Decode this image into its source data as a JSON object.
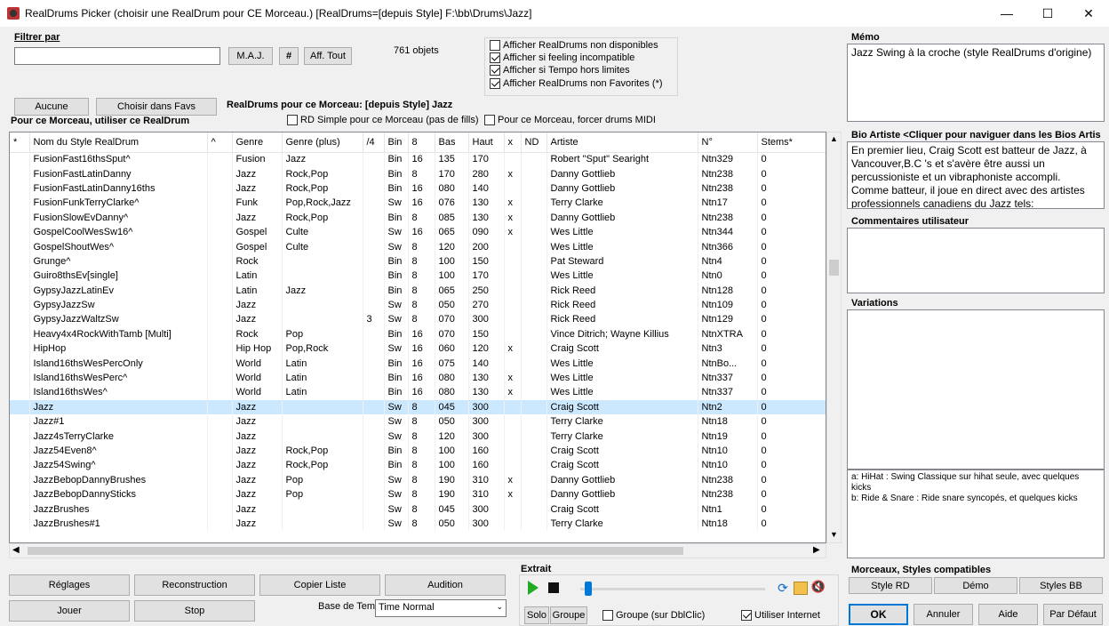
{
  "window": {
    "title": "RealDrums Picker (choisir une RealDrum pour CE Morceau.)  [RealDrums=[depuis Style] F:\\bb\\Drums\\Jazz]",
    "min": "—",
    "max": "☐",
    "close": "✕"
  },
  "filter": {
    "label": "Filtrer par",
    "value": "",
    "update": "M.A.J.",
    "hash": "#",
    "show_all": "Aff. Tout",
    "count": "761 objets"
  },
  "options": {
    "unavailable": "Afficher RealDrums non disponibles",
    "feel": "Afficher si feeling incompatible",
    "tempo": "Afficher si Tempo hors limites",
    "nonfav": "Afficher RealDrums non Favorites (*)"
  },
  "actions": {
    "none": "Aucune",
    "favs": "Choisir dans Favs",
    "for_song_title": "RealDrums pour ce Morceau: [depuis Style] Jazz",
    "use_label": "Pour ce Morceau, utiliser ce RealDrum",
    "simple_rd": "RD Simple pour ce Morceau (pas de fills)",
    "force_midi": "Pour ce Morceau, forcer drums MIDI"
  },
  "table": {
    "columns": [
      "*",
      "Nom du Style RealDrum",
      "^",
      "Genre",
      "Genre (plus)",
      "/4",
      "Bin",
      "8",
      "Bas",
      "Haut",
      "x",
      "ND",
      "Artiste",
      "N°",
      "Stems*"
    ],
    "rows": [
      [
        "",
        "FusionFast16thsSput^",
        "",
        "Fusion",
        "Jazz",
        "",
        "Bin",
        "16",
        "135",
        "170",
        "",
        "",
        "Robert \"Sput\" Searight",
        "Ntn329",
        "0"
      ],
      [
        "",
        "FusionFastLatinDanny",
        "",
        "Jazz",
        "Rock,Pop",
        "",
        "Bin",
        "8",
        "170",
        "280",
        "x",
        "",
        "Danny Gottlieb",
        "Ntn238",
        "0"
      ],
      [
        "",
        "FusionFastLatinDanny16ths",
        "",
        "Jazz",
        "Rock,Pop",
        "",
        "Bin",
        "16",
        "080",
        "140",
        "",
        "",
        "Danny Gottlieb",
        "Ntn238",
        "0"
      ],
      [
        "",
        "FusionFunkTerryClarke^",
        "",
        "Funk",
        "Pop,Rock,Jazz",
        "",
        "Sw",
        "16",
        "076",
        "130",
        "x",
        "",
        "Terry Clarke",
        "Ntn17",
        "0"
      ],
      [
        "",
        "FusionSlowEvDanny^",
        "",
        "Jazz",
        "Rock,Pop",
        "",
        "Bin",
        "8",
        "085",
        "130",
        "x",
        "",
        "Danny Gottlieb",
        "Ntn238",
        "0"
      ],
      [
        "",
        "GospelCoolWesSw16^",
        "",
        "Gospel",
        "Culte",
        "",
        "Sw",
        "16",
        "065",
        "090",
        "x",
        "",
        "Wes Little",
        "Ntn344",
        "0"
      ],
      [
        "",
        "GospelShoutWes^",
        "",
        "Gospel",
        "Culte",
        "",
        "Sw",
        "8",
        "120",
        "200",
        "",
        "",
        "Wes Little",
        "Ntn366",
        "0"
      ],
      [
        "",
        "Grunge^",
        "",
        "Rock",
        "",
        "",
        "Bin",
        "8",
        "100",
        "150",
        "",
        "",
        "Pat Steward",
        "Ntn4",
        "0"
      ],
      [
        "",
        "Guiro8thsEv[single]",
        "",
        "Latin",
        "",
        "",
        "Bin",
        "8",
        "100",
        "170",
        "",
        "",
        "Wes Little",
        "Ntn0",
        "0"
      ],
      [
        "",
        "GypsyJazzLatinEv",
        "",
        "Latin",
        "Jazz",
        "",
        "Bin",
        "8",
        "065",
        "250",
        "",
        "",
        "Rick Reed",
        "Ntn128",
        "0"
      ],
      [
        "",
        "GypsyJazzSw",
        "",
        "Jazz",
        "",
        "",
        "Sw",
        "8",
        "050",
        "270",
        "",
        "",
        "Rick Reed",
        "Ntn109",
        "0"
      ],
      [
        "",
        "GypsyJazzWaltzSw",
        "",
        "Jazz",
        "",
        "3",
        "Sw",
        "8",
        "070",
        "300",
        "",
        "",
        "Rick Reed",
        "Ntn129",
        "0"
      ],
      [
        "",
        "Heavy4x4RockWithTamb [Multi]",
        "",
        "Rock",
        "Pop",
        "",
        "Bin",
        "16",
        "070",
        "150",
        "",
        "",
        "Vince Ditrich; Wayne Killius",
        "NtnXTRA",
        "0"
      ],
      [
        "",
        "HipHop",
        "",
        "Hip Hop",
        "Pop,Rock",
        "",
        "Sw",
        "16",
        "060",
        "120",
        "x",
        "",
        "Craig Scott",
        "Ntn3",
        "0"
      ],
      [
        "",
        "Island16thsWesPercOnly",
        "",
        "World",
        "Latin",
        "",
        "Bin",
        "16",
        "075",
        "140",
        "",
        "",
        "Wes Little",
        "NtnBo...",
        "0"
      ],
      [
        "",
        "Island16thsWesPerc^",
        "",
        "World",
        "Latin",
        "",
        "Bin",
        "16",
        "080",
        "130",
        "x",
        "",
        "Wes Little",
        "Ntn337",
        "0"
      ],
      [
        "",
        "Island16thsWes^",
        "",
        "World",
        "Latin",
        "",
        "Bin",
        "16",
        "080",
        "130",
        "x",
        "",
        "Wes Little",
        "Ntn337",
        "0"
      ],
      [
        "",
        "Jazz",
        "",
        "Jazz",
        "",
        "",
        "Sw",
        "8",
        "045",
        "300",
        "",
        "",
        "Craig Scott",
        "Ntn2",
        "0"
      ],
      [
        "",
        "Jazz#1",
        "",
        "Jazz",
        "",
        "",
        "Sw",
        "8",
        "050",
        "300",
        "",
        "",
        "Terry Clarke",
        "Ntn18",
        "0"
      ],
      [
        "",
        "Jazz4sTerryClarke",
        "",
        "Jazz",
        "",
        "",
        "Sw",
        "8",
        "120",
        "300",
        "",
        "",
        "Terry Clarke",
        "Ntn19",
        "0"
      ],
      [
        "",
        "Jazz54Even8^",
        "",
        "Jazz",
        "Rock,Pop",
        "",
        "Bin",
        "8",
        "100",
        "160",
        "",
        "",
        "Craig Scott",
        "Ntn10",
        "0"
      ],
      [
        "",
        "Jazz54Swing^",
        "",
        "Jazz",
        "Rock,Pop",
        "",
        "Bin",
        "8",
        "100",
        "160",
        "",
        "",
        "Craig Scott",
        "Ntn10",
        "0"
      ],
      [
        "",
        "JazzBebopDannyBrushes",
        "",
        "Jazz",
        "Pop",
        "",
        "Sw",
        "8",
        "190",
        "310",
        "x",
        "",
        "Danny Gottlieb",
        "Ntn238",
        "0"
      ],
      [
        "",
        "JazzBebopDannySticks",
        "",
        "Jazz",
        "Pop",
        "",
        "Sw",
        "8",
        "190",
        "310",
        "x",
        "",
        "Danny Gottlieb",
        "Ntn238",
        "0"
      ],
      [
        "",
        "JazzBrushes",
        "",
        "Jazz",
        "",
        "",
        "Sw",
        "8",
        "045",
        "300",
        "",
        "",
        "Craig Scott",
        "Ntn1",
        "0"
      ],
      [
        "",
        "JazzBrushes#1",
        "",
        "Jazz",
        "",
        "",
        "Sw",
        "8",
        "050",
        "300",
        "",
        "",
        "Terry Clarke",
        "Ntn18",
        "0"
      ]
    ],
    "selected_index": 17
  },
  "right": {
    "memo_label": "Mémo",
    "memo_text": "Jazz Swing à la croche (style RealDrums d'origine)",
    "bio_label": "Bio Artiste  <Cliquer pour naviguer dans les Bios Artis",
    "bio_text": "En premier lieu, Craig Scott est batteur de Jazz, à Vancouver,B.C 's et s'avère être aussi un percussioniste et un vibraphoniste accompli. Comme batteur, il joue en direct avec des artistes professionnels canadiens du Jazz tels:",
    "comments_label": "Commentaires utilisateur",
    "variations_label": "Variations",
    "variations_text_a": "a: HiHat : Swing Classique sur hihat seule, avec quelques kicks",
    "variations_text_b": "b: Ride & Snare : Ride snare syncopés, et quelques kicks",
    "compat_label": "Morceaux, Styles compatibles",
    "style_rd": "Style RD",
    "demo": "Démo",
    "styles_bb": "Styles BB"
  },
  "bottom": {
    "settings": "Réglages",
    "rebuild": "Reconstruction",
    "copy_list": "Copier Liste",
    "audition": "Audition",
    "play": "Jouer",
    "stop": "Stop",
    "timebase_label": "Base de Temps",
    "timebase_value": "Time Normal",
    "extract_label": "Extrait",
    "solo": "Solo",
    "group": "Groupe",
    "group_dbl": "Groupe (sur DblClic)",
    "use_internet": "Utiliser Internet",
    "ok": "OK",
    "cancel": "Annuler",
    "help": "Aide",
    "default": "Par Défaut"
  }
}
